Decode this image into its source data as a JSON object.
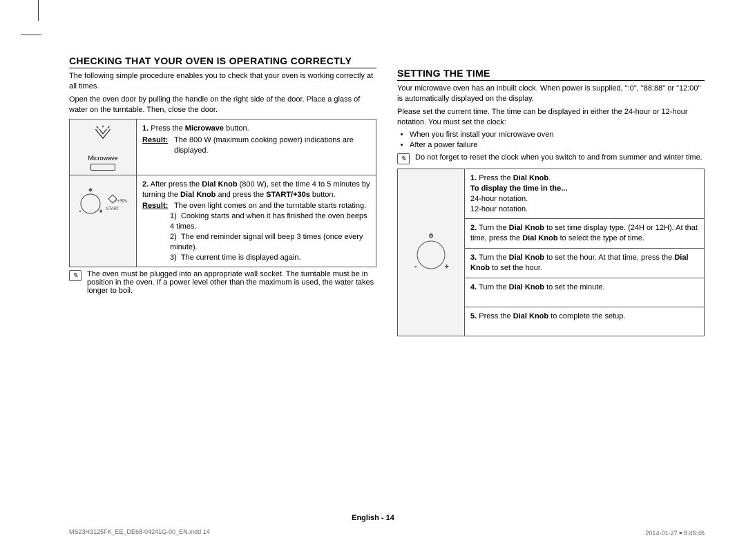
{
  "left": {
    "heading": "CHECKING THAT YOUR OVEN IS OPERATING CORRECTLY",
    "intro1": "The following simple procedure enables you to check that your oven is working correctly at all times.",
    "intro2": "Open the oven door by pulling the handle on the right side of the door. Place a glass of water on the turntable. Then, close the door.",
    "icon1_label": "Microwave",
    "step1_num": "1.",
    "step1_text": "Press the ",
    "step1_bold": "Microwave",
    "step1_cont": " button.",
    "step1_result_label": "Result:",
    "step1_result_text": "The 800 W (maximum cooking power) indications are displayed.",
    "icon2a": "/+30s",
    "icon2b": "START",
    "step2_num": "2.",
    "step2_pre": "After press the ",
    "step2_b1": "Dial Knob",
    "step2_mid": " (800 W), set the time 4 to 5 minutes by turning the ",
    "step2_b2": "Dial Knob",
    "step2_mid2": " and press the ",
    "step2_b3": "START/+30s",
    "step2_end": " button.",
    "step2_result_label": "Result:",
    "step2_result_text": "The oven light comes on and the turntable starts rotating.",
    "step2_li1_n": "1)",
    "step2_li1": "Cooking starts and when it has finished the oven beeps 4 times.",
    "step2_li2_n": "2)",
    "step2_li2": "The end reminder signal will beep 3 times (once every minute).",
    "step2_li3_n": "3)",
    "step2_li3": "The current time is displayed again.",
    "note": "The oven must be plugged into an appropriate wall socket. The turntable must be in position in the oven. If a power level other than the maximum is used, the water takes longer to boil."
  },
  "right": {
    "heading": "SETTING THE TIME",
    "intro1": "Your microwave oven has an inbuilt clock. When power is supplied, \":0\", \"88:88\" or \"12:00\" is automatically displayed on the display.",
    "intro2": "Please set the current time. The time can be displayed in either the 24-hour or 12-hour notation. You must set the clock:",
    "bullet1": "When you first install your microwave oven",
    "bullet2": "After a power failure",
    "note": "Do not forget to reset the clock when you switch to and from summer and winter time.",
    "s1_num": "1.",
    "s1_pre": "Press the ",
    "s1_b": "Dial Knob",
    "s1_end": ".",
    "s1_sub_label": "To display the time in the...",
    "s1_sub1": "24-hour notation.",
    "s1_sub2": "12-hour notation.",
    "s2_num": "2.",
    "s2_pre": "Turn the ",
    "s2_b1": "Dial Knob",
    "s2_mid": " to set time display type. (24H or 12H). At that time, press the ",
    "s2_b2": "Dial Knob",
    "s2_end": " to select the type of time.",
    "s3_num": "3.",
    "s3_pre": "Turn the ",
    "s3_b1": "Dial Knob",
    "s3_mid": " to set the hour. At that time, press the ",
    "s3_b2": "Dial Knob",
    "s3_end": " to set the hour.",
    "s4_num": "4.",
    "s4_pre": "Turn the ",
    "s4_b": "Dial Knob",
    "s4_end": " to set the minute.",
    "s5_num": "5.",
    "s5_pre": "Press the ",
    "s5_b": "Dial Knob",
    "s5_end": " to complete the setup."
  },
  "footer": {
    "center": "English - 14",
    "file": "MS23H3125FK_EE_DE68-04241G-00_EN.indd   14",
    "date": "2014-01-27   ￭ 8:46:46"
  }
}
